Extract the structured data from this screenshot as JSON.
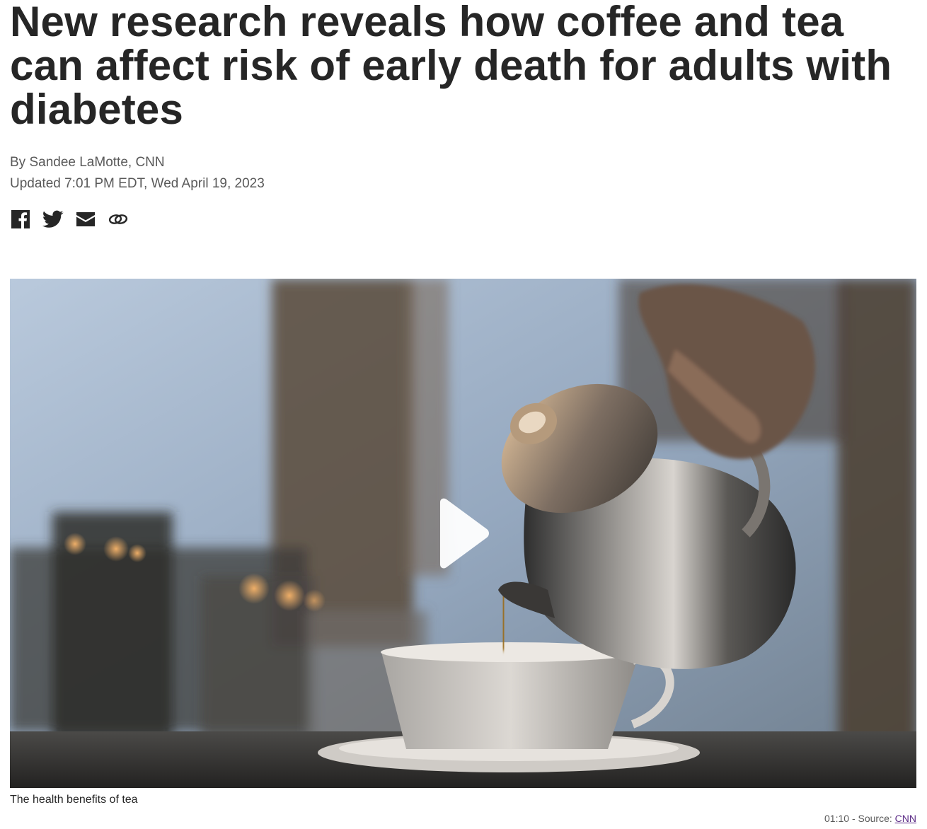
{
  "article": {
    "headline": "New research reveals how coffee and tea can affect risk of early death for adults with diabetes",
    "byline": "By Sandee LaMotte, CNN",
    "updated": "Updated 7:01 PM EDT, Wed April 19, 2023"
  },
  "share": {
    "items": [
      {
        "icon": "facebook-icon"
      },
      {
        "icon": "twitter-icon"
      },
      {
        "icon": "email-icon"
      },
      {
        "icon": "link-icon"
      }
    ]
  },
  "video": {
    "caption": "The health benefits of tea",
    "duration": "01:10",
    "source_prefix": " - Source: ",
    "source_link": "CNN",
    "play_icon": "play-icon"
  },
  "colors": {
    "text": "#262626",
    "meta_text": "#595959",
    "link": "#5b2a86"
  }
}
